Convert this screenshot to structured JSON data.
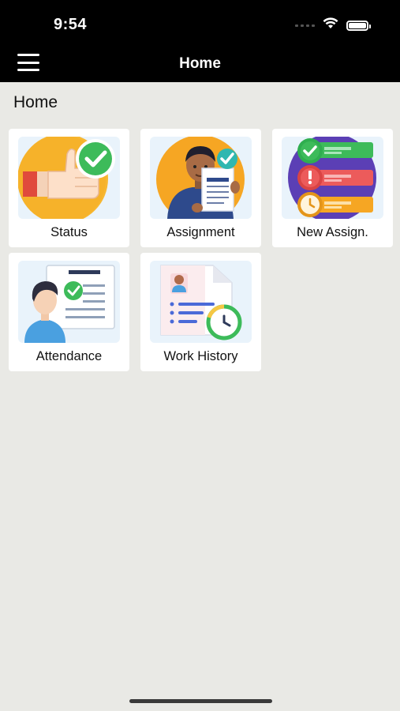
{
  "status_bar": {
    "time": "9:54"
  },
  "nav": {
    "title": "Home"
  },
  "page": {
    "heading": "Home"
  },
  "tiles": [
    {
      "label": "Status",
      "icon": "thumbs-up-check-icon"
    },
    {
      "label": "Assignment",
      "icon": "person-with-document-icon"
    },
    {
      "label": "New Assign.",
      "icon": "task-list-icon"
    },
    {
      "label": "Attendance",
      "icon": "person-checked-board-icon"
    },
    {
      "label": "Work History",
      "icon": "profile-document-clock-icon"
    }
  ],
  "colors": {
    "top_bar": "#000000",
    "background": "#e9e9e5",
    "tile": "#ffffff",
    "icon_backdrop": "#e9f3fb"
  }
}
